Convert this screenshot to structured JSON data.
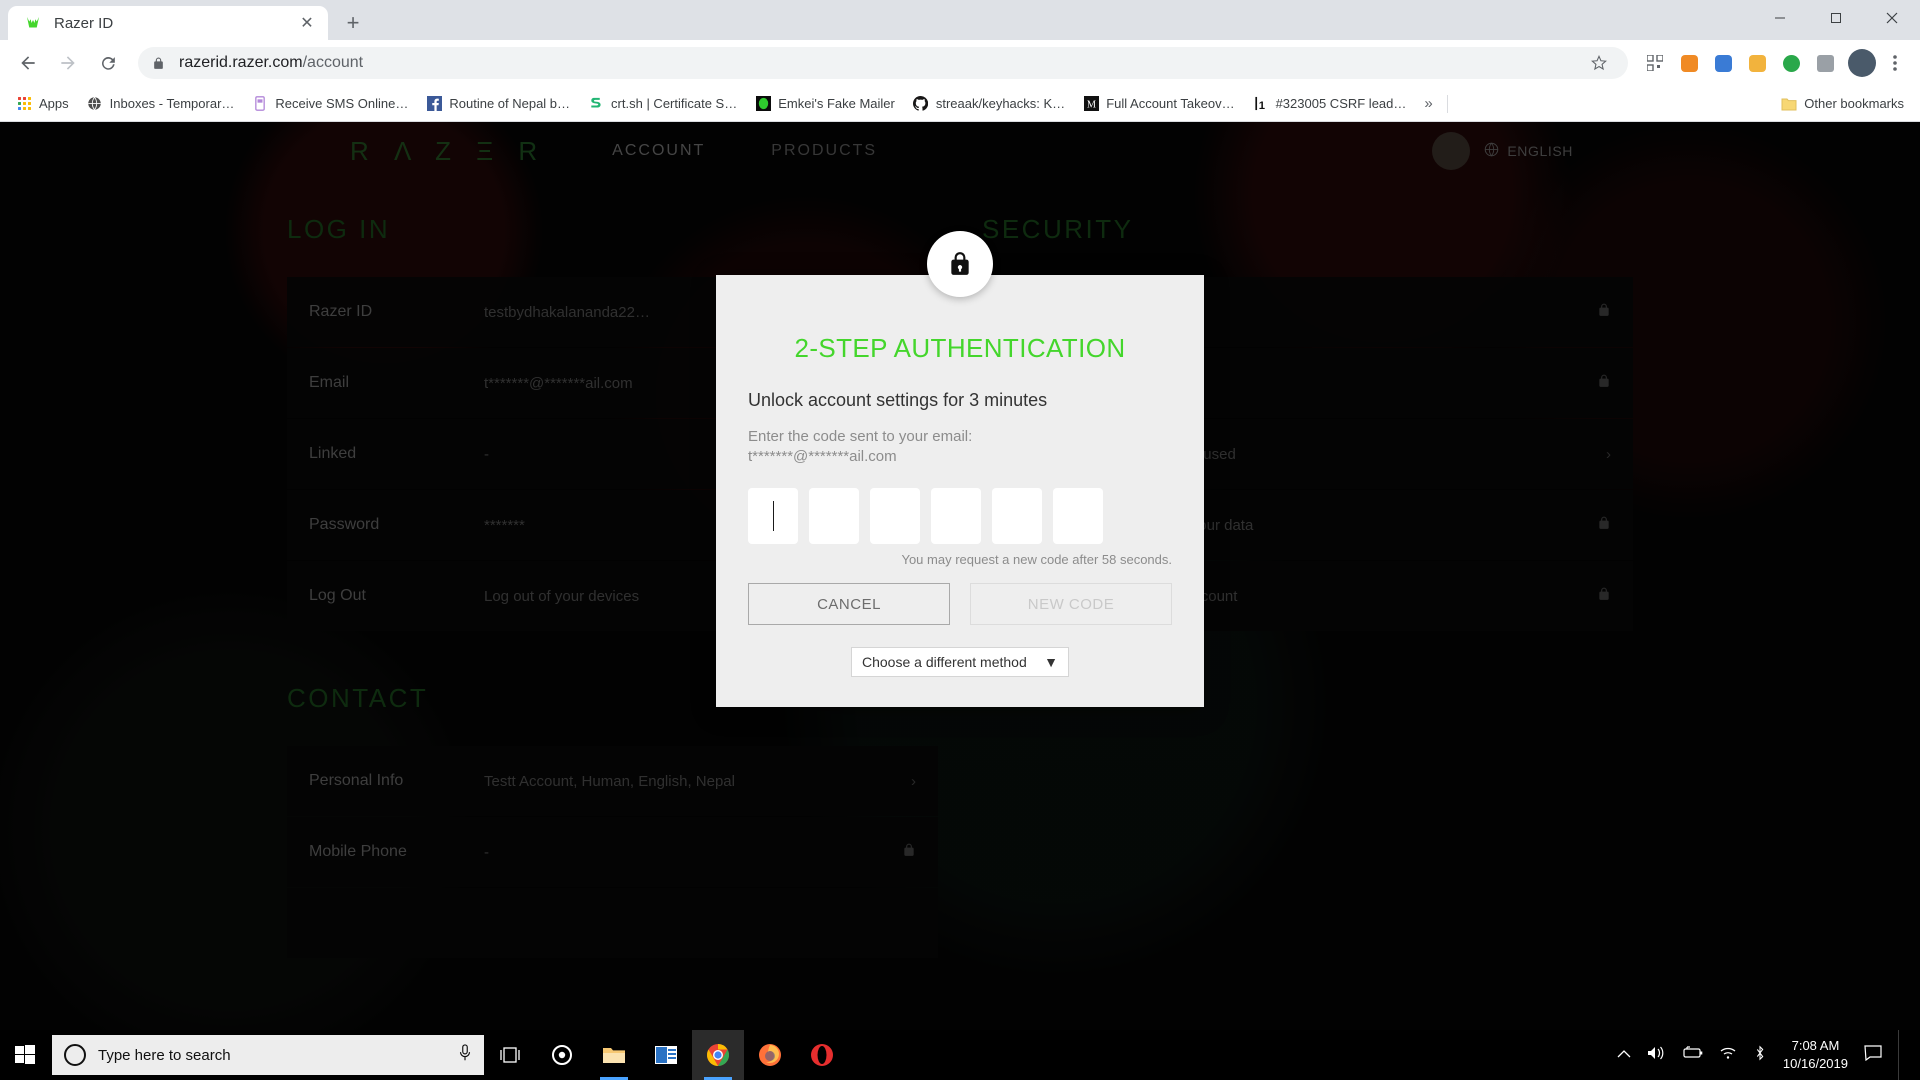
{
  "browser": {
    "tab": {
      "title": "Razer ID",
      "favicon": "razer-logo-icon",
      "close_label": "✕"
    },
    "new_tab_label": "+",
    "window_controls": {
      "minimize": "—",
      "maximize": "☐",
      "close": "✕"
    },
    "nav": {
      "back": "←",
      "forward": "→",
      "reload": "↻"
    },
    "omnibox": {
      "lock_icon": "lock-icon",
      "url_domain": "razerid.razer.com",
      "url_path": "/account",
      "star_icon": "bookmark-star-icon"
    },
    "toolbar_icons": [
      "qr-code-icon",
      "extension-orange-icon",
      "extension-blue-icon",
      "extension-yellow-icon",
      "extension-green-icon",
      "extension-gray-icon"
    ],
    "profile_avatar": "profile-avatar",
    "menu_icon": "three-dot-menu-icon",
    "bookmarks": [
      {
        "label": "Apps",
        "icon": "apps-grid-icon"
      },
      {
        "label": "Inboxes - Temporar…",
        "icon": "globe-icon"
      },
      {
        "label": "Receive SMS Online…",
        "icon": "sms-icon"
      },
      {
        "label": "Routine of Nepal b…",
        "icon": "facebook-icon"
      },
      {
        "label": "crt.sh | Certificate S…",
        "icon": "crtsh-icon"
      },
      {
        "label": "Emkei's Fake Mailer",
        "icon": "emkei-icon"
      },
      {
        "label": "streaak/keyhacks: K…",
        "icon": "github-icon"
      },
      {
        "label": "Full Account Takeov…",
        "icon": "medium-icon"
      },
      {
        "label": "#323005 CSRF lead…",
        "icon": "hackerone-icon"
      }
    ],
    "bookmarks_overflow": "»",
    "other_bookmarks": {
      "label": "Other bookmarks",
      "icon": "folder-icon"
    }
  },
  "site": {
    "logo": "R Λ Z Ξ R",
    "nav": [
      {
        "label": "ACCOUNT",
        "active": true
      },
      {
        "label": "PRODUCTS",
        "active": false
      }
    ],
    "language": "ENGLISH",
    "language_icon": "globe-icon",
    "avatar": "user-avatar",
    "sections": {
      "login": {
        "title": "LOG IN",
        "rows": [
          {
            "label": "Razer ID",
            "value": "testbydhakalananda22…",
            "icon": "lock-icon"
          },
          {
            "label": "Email",
            "value": "t*******@*******ail.com",
            "icon": "lock-icon"
          },
          {
            "label": "Linked",
            "value": "-",
            "icon": ""
          },
          {
            "label": "Password",
            "value": "*******",
            "icon": ""
          },
          {
            "label": "Log Out",
            "value": "Log out of your devices",
            "icon": ""
          }
        ]
      },
      "security": {
        "title": "SECURITY",
        "rows": [
          {
            "label": "",
            "value": "",
            "icon": "lock-icon"
          },
          {
            "label": "",
            "value": "",
            "icon": "lock-icon"
          },
          {
            "label": "",
            "value": "…nderstand how your data is used",
            "icon": "›"
          },
          {
            "label": "",
            "value": "…ontrol which apps access your data",
            "icon": "lock-icon"
          },
          {
            "label": "",
            "value": "…ermanently remove your account",
            "icon": "lock-icon"
          }
        ]
      },
      "contact": {
        "title": "CONTACT",
        "rows": [
          {
            "label": "Personal Info",
            "value": "Testt Account, Human, English, Nepal",
            "icon": "›"
          },
          {
            "label": "Mobile Phone",
            "value": "-",
            "icon": "lock-icon"
          }
        ]
      }
    }
  },
  "modal": {
    "lock_icon": "lock-icon",
    "title": "2-STEP AUTHENTICATION",
    "subtitle": "Unlock account settings for 3 minutes",
    "hint_line1": "Enter the code sent to your email:",
    "hint_line2": "t*******@*******ail.com",
    "code_length": 6,
    "code_values": [
      "",
      "",
      "",
      "",
      "",
      ""
    ],
    "resend_text": "You may request a new code after 58 seconds.",
    "cancel_label": "CANCEL",
    "newcode_label": "NEW CODE",
    "newcode_disabled": true,
    "method_select": {
      "value": "Choose a different method",
      "arrow": "▼"
    },
    "accent_color": "#44d62c",
    "background_color": "#eeeeee"
  },
  "taskbar": {
    "start_icon": "windows-start-icon",
    "search_placeholder": "Type here to search",
    "mic_icon": "microphone-icon",
    "buttons": [
      {
        "name": "task-view-icon",
        "running": false,
        "active": false
      },
      {
        "name": "cortana-icon",
        "running": false,
        "active": false
      },
      {
        "name": "file-explorer-icon",
        "running": true,
        "active": false
      },
      {
        "name": "mail-icon",
        "running": false,
        "active": false
      },
      {
        "name": "chrome-icon",
        "running": true,
        "active": true
      },
      {
        "name": "firefox-icon",
        "running": false,
        "active": false
      },
      {
        "name": "opera-icon",
        "running": false,
        "active": false
      }
    ],
    "tray_icons": [
      "chevron-up-icon",
      "volume-icon",
      "battery-icon",
      "wifi-icon",
      "bluetooth-icon"
    ],
    "time": "7:08 AM",
    "date": "10/16/2019",
    "action_center_icon": "action-center-icon"
  }
}
